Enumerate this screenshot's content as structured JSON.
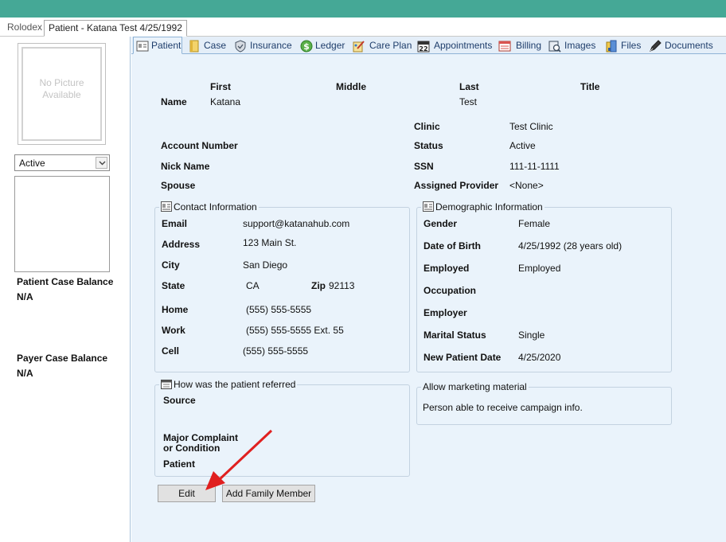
{
  "doc_tabs": {
    "rolodex": "Rolodex",
    "patient": "Patient - Katana Test 4/25/1992"
  },
  "left": {
    "no_picture_line1": "No Picture",
    "no_picture_line2": "Available",
    "status_value": "Active",
    "patient_case_balance_label": "Patient Case Balance",
    "patient_case_balance_value": "N/A",
    "payer_case_balance_label": "Payer Case Balance",
    "payer_case_balance_value": "N/A"
  },
  "tabs": [
    {
      "label": "Patient",
      "icon": "patient-card-icon"
    },
    {
      "label": "Case",
      "icon": "case-folder-icon"
    },
    {
      "label": "Insurance",
      "icon": "shield-icon"
    },
    {
      "label": "Ledger",
      "icon": "dollar-icon"
    },
    {
      "label": "Care Plan",
      "icon": "care-plan-icon"
    },
    {
      "label": "Appointments",
      "icon": "calendar-icon"
    },
    {
      "label": "Billing",
      "icon": "billing-icon"
    },
    {
      "label": "Images",
      "icon": "images-icon"
    },
    {
      "label": "Files",
      "icon": "files-icon"
    },
    {
      "label": "Documents",
      "icon": "pen-icon"
    }
  ],
  "patient": {
    "name_headers": {
      "first": "First",
      "middle": "Middle",
      "last": "Last",
      "title": "Title"
    },
    "name_label": "Name",
    "first": "Katana",
    "last": "Test",
    "clinic_label": "Clinic",
    "clinic": "Test Clinic",
    "account_number_label": "Account Number",
    "status_label": "Status",
    "status": "Active",
    "nick_name_label": "Nick Name",
    "ssn_label": "SSN",
    "ssn": "111-11-1111",
    "spouse_label": "Spouse",
    "assigned_provider_label": "Assigned Provider",
    "assigned_provider": "<None>"
  },
  "contact": {
    "title": "Contact Information",
    "email_label": "Email",
    "email": "support@katanahub.com",
    "address_label": "Address",
    "address": "123 Main St.",
    "city_label": "City",
    "city": "San Diego",
    "state_label": "State",
    "state": "CA",
    "zip_label": "Zip",
    "zip": "92113",
    "home_label": "Home",
    "home": "(555) 555-5555",
    "work_label": "Work",
    "work": "(555) 555-5555 Ext. 55",
    "cell_label": "Cell",
    "cell": "(555) 555-5555"
  },
  "demographic": {
    "title": "Demographic Information",
    "gender_label": "Gender",
    "gender": "Female",
    "dob_label": "Date of Birth",
    "dob": "4/25/1992 (28 years old)",
    "employed_label": "Employed",
    "employed": "Employed",
    "occupation_label": "Occupation",
    "employer_label": "Employer",
    "marital_label": "Marital Status",
    "marital": "Single",
    "new_patient_label": "New Patient Date",
    "new_patient": "4/25/2020"
  },
  "referral": {
    "title": "How was the patient referred",
    "source_label": "Source",
    "complaint_label_1": "Major Complaint",
    "complaint_label_2": "or Condition",
    "patient_label": "Patient"
  },
  "marketing": {
    "title": "Allow marketing material",
    "text": "Person able to receive campaign info."
  },
  "buttons": {
    "edit": "Edit",
    "add_family": "Add Family Member"
  },
  "colors": {
    "topbar": "#45a896",
    "main_bg": "#eaf3fb",
    "annotation_arrow": "#e02020"
  }
}
